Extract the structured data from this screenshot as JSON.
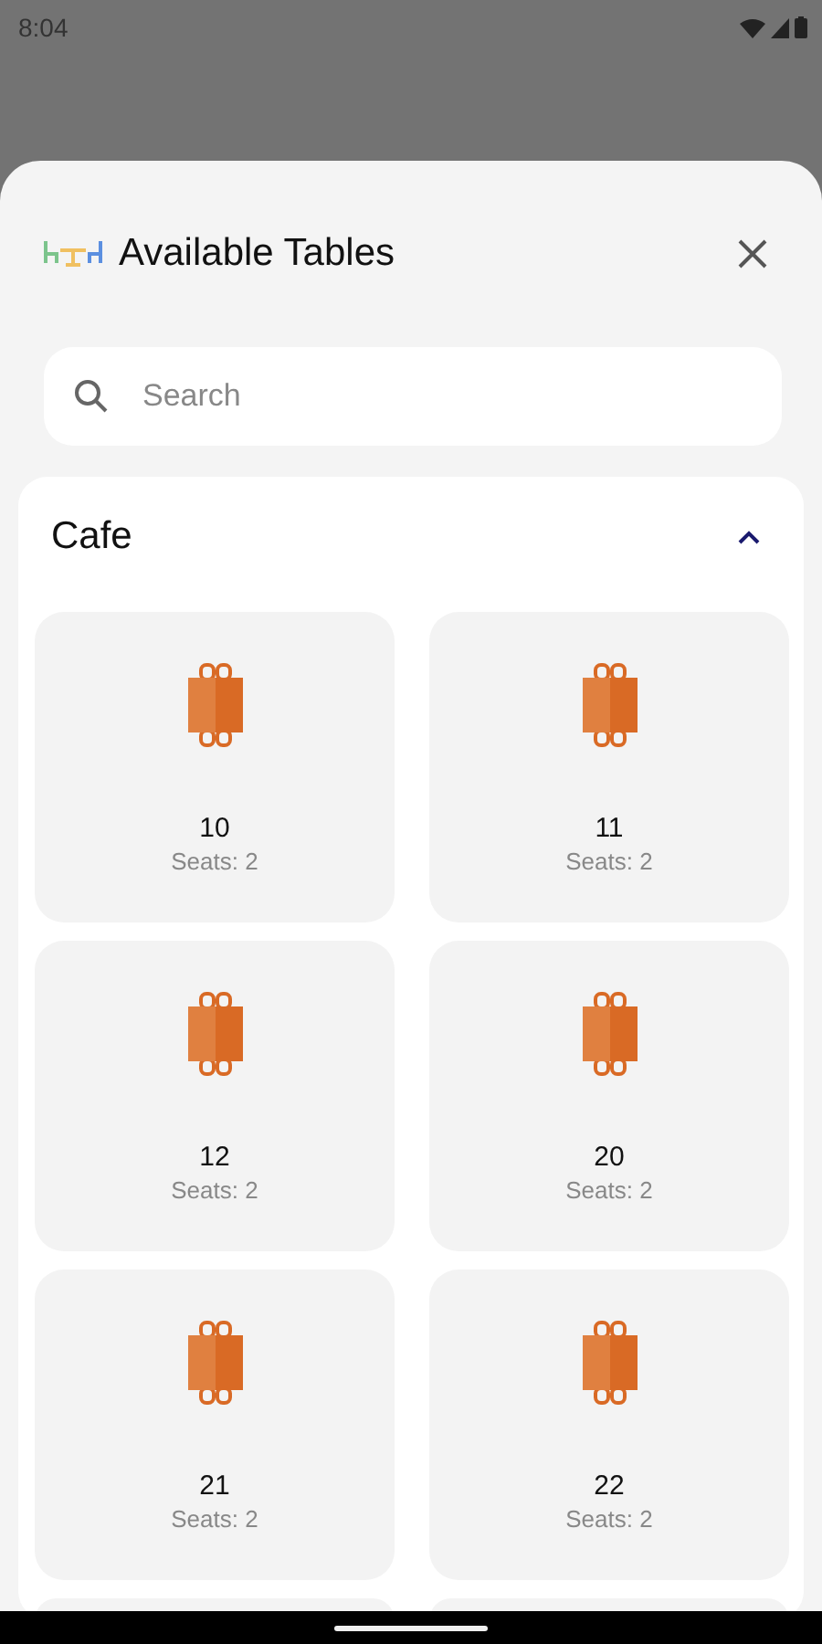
{
  "status_bar": {
    "time": "8:04"
  },
  "sheet": {
    "title": "Available Tables",
    "search": {
      "placeholder": "Search"
    }
  },
  "sections": [
    {
      "name": "Cafe",
      "expanded": true,
      "tables": [
        {
          "number": "10",
          "seats": "Seats: 2"
        },
        {
          "number": "11",
          "seats": "Seats: 2"
        },
        {
          "number": "12",
          "seats": "Seats: 2"
        },
        {
          "number": "20",
          "seats": "Seats: 2"
        },
        {
          "number": "21",
          "seats": "Seats: 2"
        },
        {
          "number": "22",
          "seats": "Seats: 2"
        }
      ]
    }
  ]
}
